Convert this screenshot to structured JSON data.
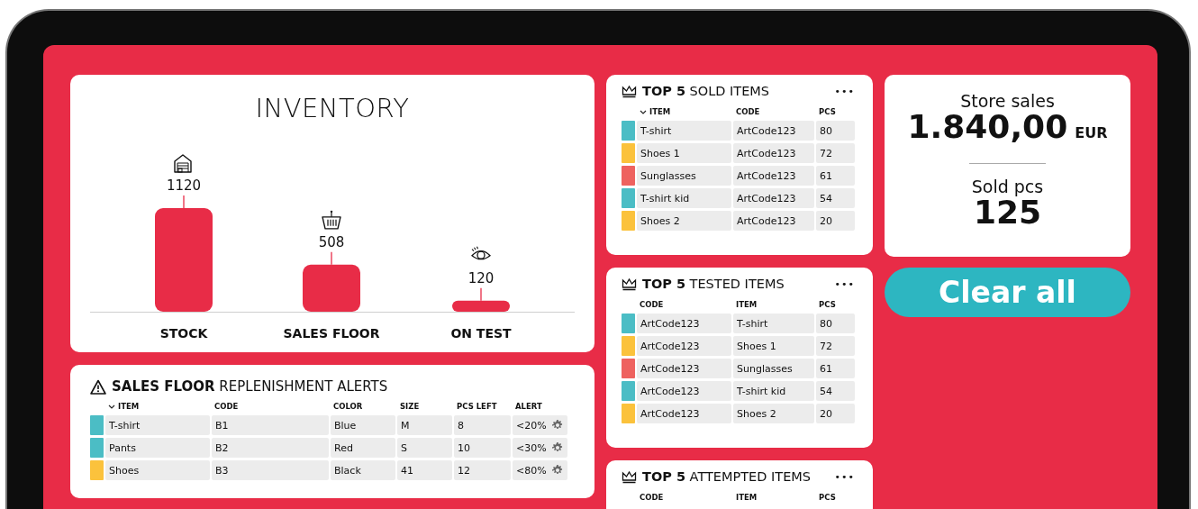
{
  "inventory": {
    "title": "INVENTORY",
    "chart_data": {
      "type": "bar",
      "categories": [
        "STOCK",
        "SALES FLOOR",
        "ON TEST"
      ],
      "values": [
        1120,
        508,
        120
      ],
      "data_labels": true
    }
  },
  "alerts": {
    "title": "**SALES FLOOR** REPLENISHMENT ALERTS",
    "columns": [
      {
        "label": "ITEM",
        "sorted": true
      },
      {
        "label": "CODE",
        "sorted": false
      },
      {
        "label": "COLOR",
        "sorted": false
      },
      {
        "label": "SIZE",
        "sorted": false
      },
      {
        "label": "PCS LEFT",
        "sorted": false
      },
      {
        "label": "ALERT",
        "sorted": false
      }
    ],
    "rows": [
      {
        "color": "#4bbdc5",
        "cells": [
          "T-shirt",
          "B1",
          "Blue",
          "M",
          "8",
          "<20%"
        ]
      },
      {
        "color": "#4bbdc5",
        "cells": [
          "Pants",
          "B2",
          "Red",
          "S",
          "10",
          "<30%"
        ]
      },
      {
        "color": "#fbc23c",
        "cells": [
          "Shoes",
          "B3",
          "Black",
          "41",
          "12",
          "<80%"
        ]
      }
    ]
  },
  "top_lists": [
    {
      "title": "**TOP 5** SOLD ITEMS",
      "more": "•••",
      "columns": [
        {
          "label": "ITEM",
          "sorted": true
        },
        {
          "label": "CODE",
          "sorted": false
        },
        {
          "label": "PCS",
          "sorted": false
        }
      ],
      "rows": [
        {
          "color": "#4bbdc5",
          "cells": [
            "T-shirt",
            "ArtCode123",
            "80"
          ]
        },
        {
          "color": "#fbc23c",
          "cells": [
            "Shoes 1",
            "ArtCode123",
            "72"
          ]
        },
        {
          "color": "#ee625f",
          "cells": [
            "Sunglasses",
            "ArtCode123",
            "61"
          ]
        },
        {
          "color": "#4bbdc5",
          "cells": [
            "T-shirt kid",
            "ArtCode123",
            "54"
          ]
        },
        {
          "color": "#fbc23c",
          "cells": [
            "Shoes 2",
            "ArtCode123",
            "20"
          ]
        }
      ]
    },
    {
      "title": "**TOP 5** TESTED ITEMS",
      "more": "•••",
      "columns": [
        {
          "label": "CODE",
          "sorted": false
        },
        {
          "label": "ITEM",
          "sorted": false
        },
        {
          "label": "PCS",
          "sorted": false
        }
      ],
      "rows": [
        {
          "color": "#4bbdc5",
          "cells": [
            "ArtCode123",
            "T-shirt",
            "80"
          ]
        },
        {
          "color": "#fbc23c",
          "cells": [
            "ArtCode123",
            "Shoes 1",
            "72"
          ]
        },
        {
          "color": "#ee625f",
          "cells": [
            "ArtCode123",
            "Sunglasses",
            "61"
          ]
        },
        {
          "color": "#4bbdc5",
          "cells": [
            "ArtCode123",
            "T-shirt kid",
            "54"
          ]
        },
        {
          "color": "#fbc23c",
          "cells": [
            "ArtCode123",
            "Shoes 2",
            "20"
          ]
        }
      ]
    },
    {
      "title": "**TOP 5** ATTEMPTED ITEMS",
      "more": "•••",
      "columns": [
        {
          "label": "CODE",
          "sorted": false
        },
        {
          "label": "ITEM",
          "sorted": false
        },
        {
          "label": "PCS",
          "sorted": false
        }
      ]
    }
  ],
  "summary": {
    "sales_label": "Store sales",
    "sales_value": "1.840,00",
    "currency": "EUR",
    "pcs_label": "Sold pcs",
    "pcs_value": "125"
  },
  "clear_button": "Clear all"
}
